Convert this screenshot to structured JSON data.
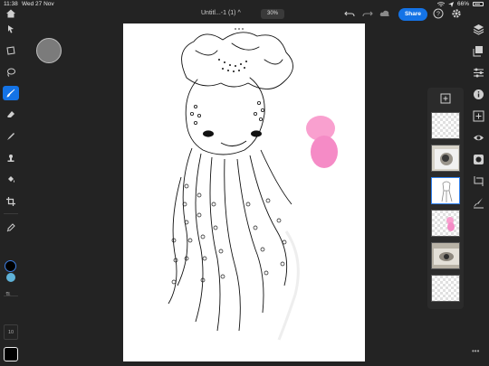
{
  "status_bar": {
    "time": "11:38",
    "date": "Wed 27 Nov",
    "battery": "66%"
  },
  "header": {
    "title": "Untitl...-1 (1)",
    "title_caret": "^",
    "zoom": "30%",
    "share_label": "Share"
  },
  "tools": {
    "brush_size": "10",
    "active_tool": "brush",
    "foreground_color": "#000000",
    "background_color": "#5fb2d8",
    "swap_label": "⇅",
    "more_label": "•••"
  },
  "layers_panel": {
    "layers": [
      {
        "name": "layer-1",
        "kind": "empty",
        "selected": false
      },
      {
        "name": "layer-2",
        "kind": "photo",
        "selected": false
      },
      {
        "name": "layer-3",
        "kind": "sketch",
        "selected": true
      },
      {
        "name": "layer-4",
        "kind": "pink-blobs",
        "selected": false
      },
      {
        "name": "layer-5",
        "kind": "photo",
        "selected": false
      },
      {
        "name": "layer-6",
        "kind": "empty",
        "selected": false
      }
    ]
  },
  "right_more_label": "•••",
  "colors": {
    "accent": "#1473e6",
    "pink": "#f58bc6",
    "canvas": "#ffffff"
  }
}
